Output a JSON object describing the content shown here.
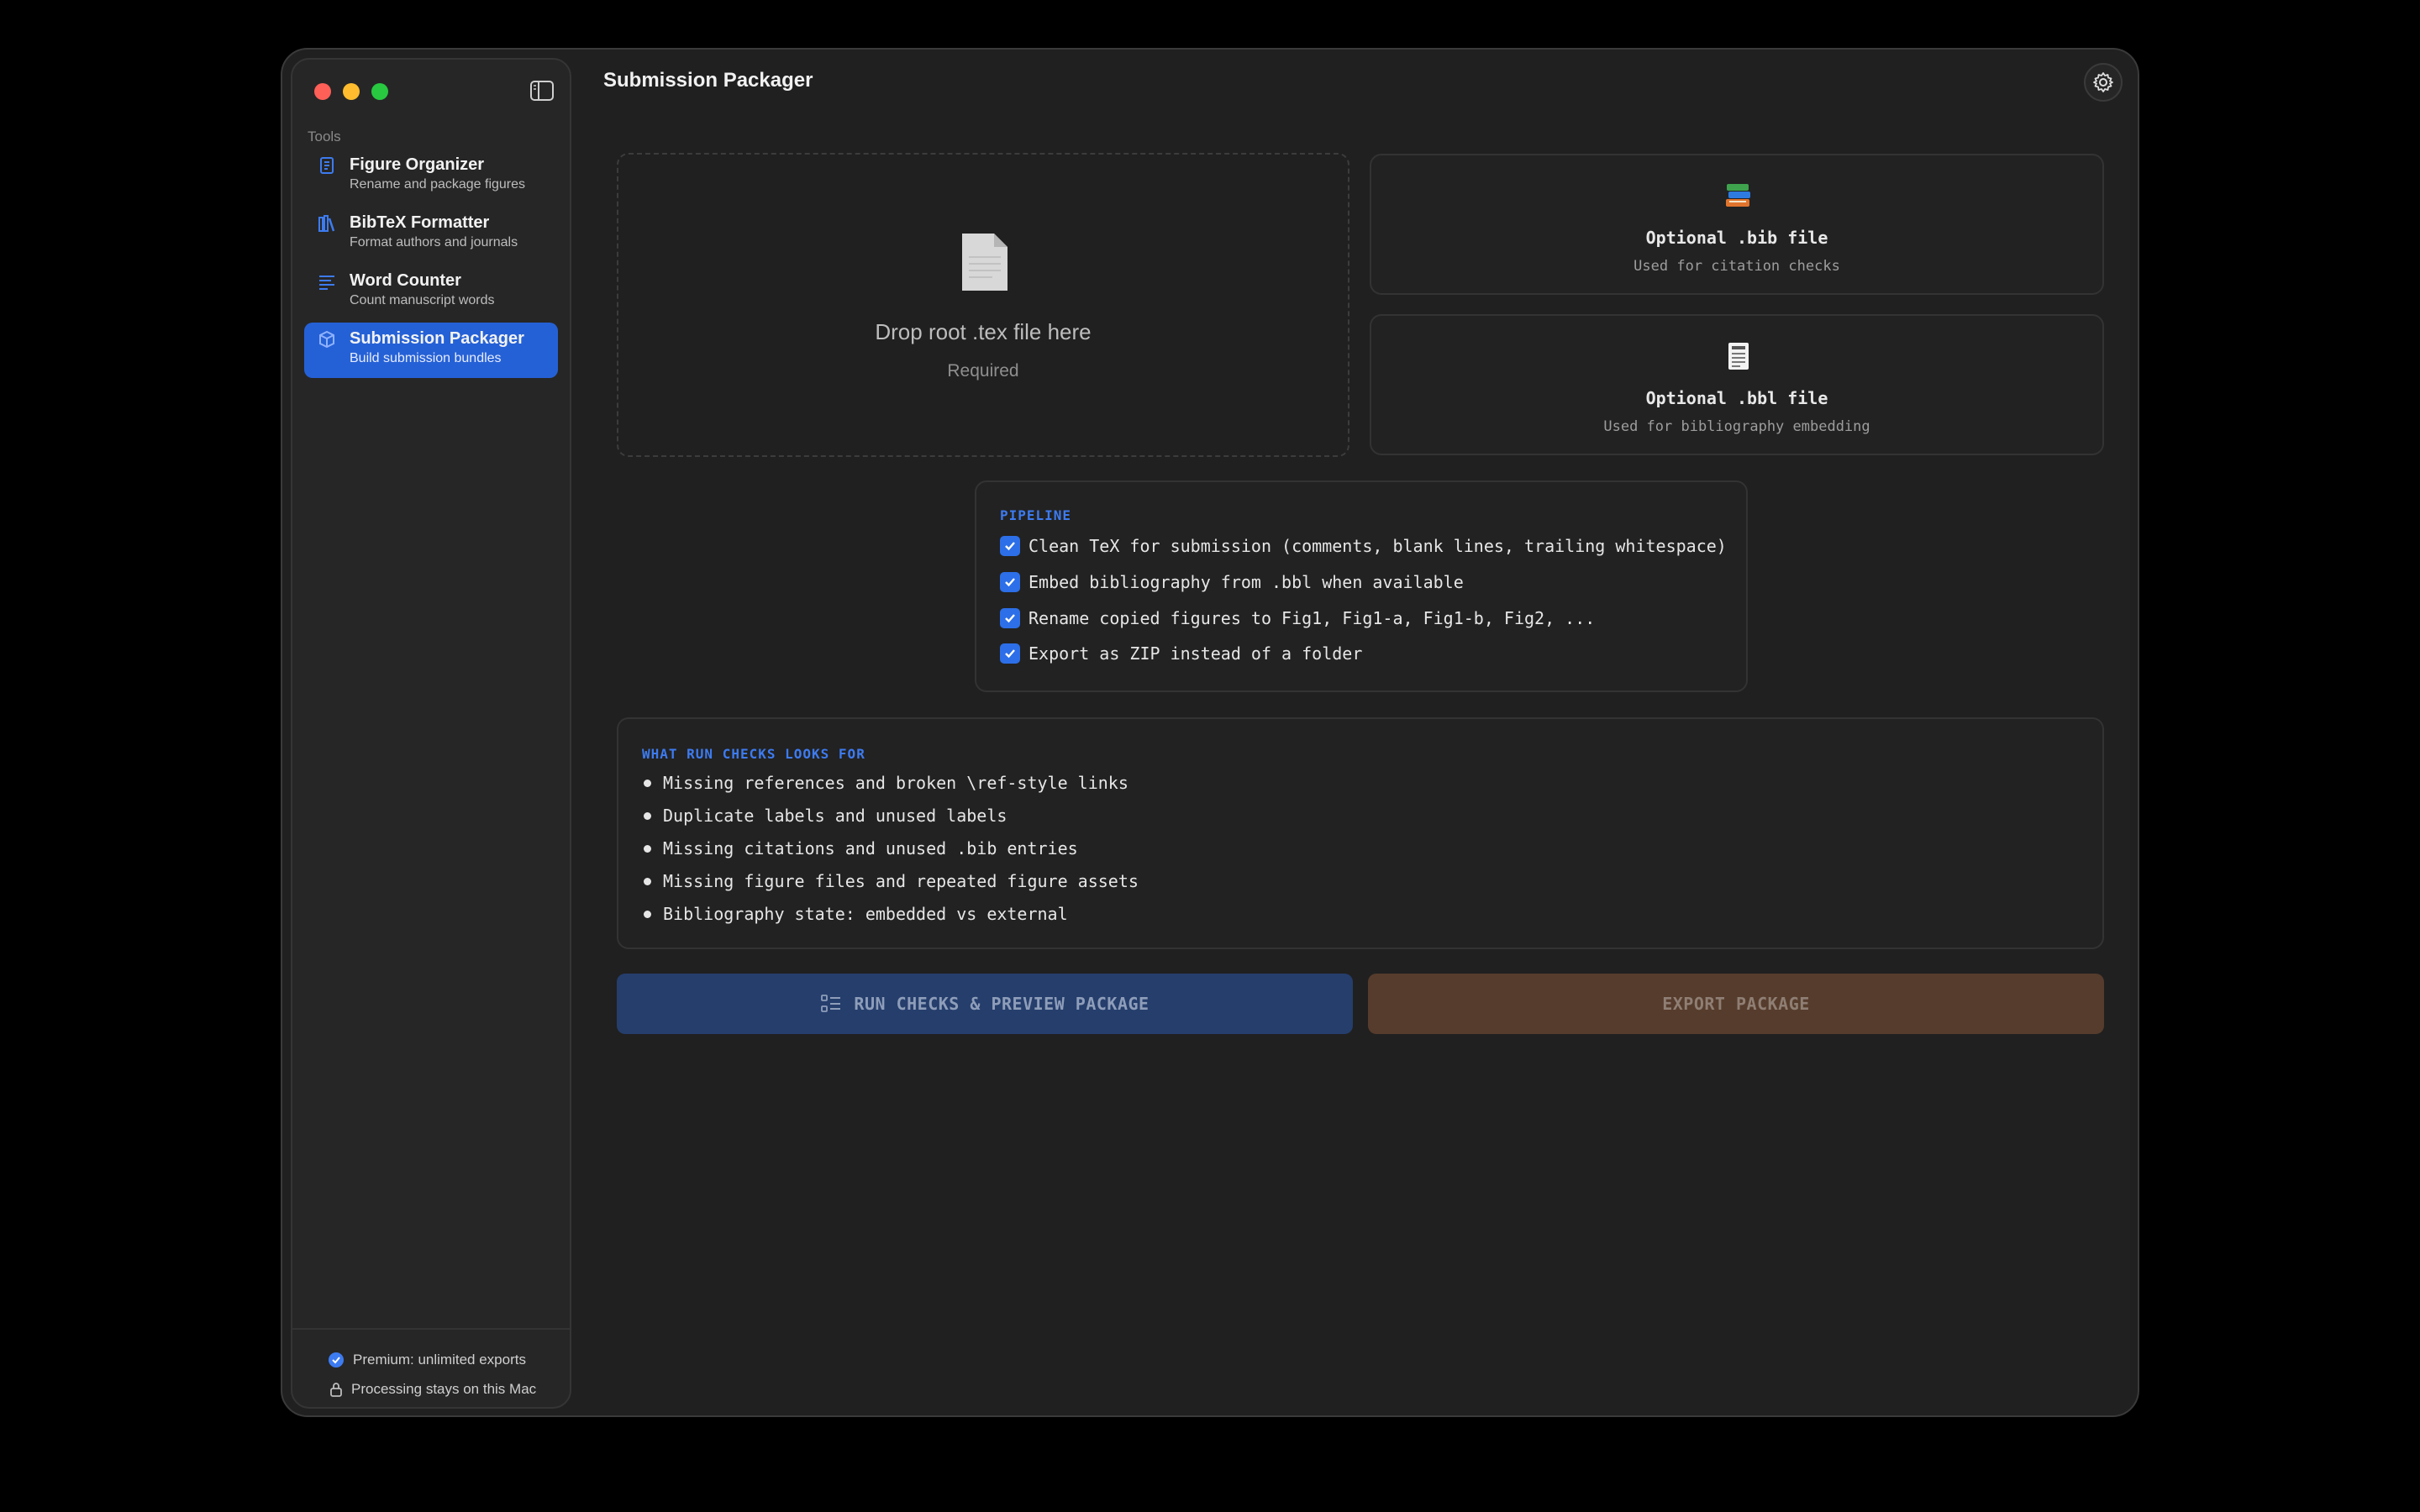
{
  "window": {
    "title": "Submission Packager"
  },
  "sidebar": {
    "section_label": "Tools",
    "items": [
      {
        "title": "Figure Organizer",
        "subtitle": "Rename and package figures",
        "icon": "figure-doc-icon",
        "active": false
      },
      {
        "title": "BibTeX Formatter",
        "subtitle": "Format authors and journals",
        "icon": "books-icon",
        "active": false
      },
      {
        "title": "Word Counter",
        "subtitle": "Count manuscript words",
        "icon": "text-lines-icon",
        "active": false
      },
      {
        "title": "Submission Packager",
        "subtitle": "Build submission bundles",
        "icon": "package-icon",
        "active": true
      }
    ],
    "footer": {
      "premium": "Premium: unlimited exports",
      "privacy": "Processing stays on this Mac"
    }
  },
  "dropzone": {
    "title": "Drop root .tex file here",
    "subtitle": "Required"
  },
  "optional": {
    "bib": {
      "title": "Optional .bib file",
      "subtitle": "Used for citation checks"
    },
    "bbl": {
      "title": "Optional .bbl file",
      "subtitle": "Used for bibliography embedding"
    }
  },
  "pipeline": {
    "title": "PIPELINE",
    "options": [
      {
        "label": "Clean TeX for submission (comments, blank lines, trailing whitespace)",
        "checked": true
      },
      {
        "label": "Embed bibliography from .bbl when available",
        "checked": true
      },
      {
        "label": "Rename copied figures to Fig1, Fig1-a, Fig1-b, Fig2, ...",
        "checked": true
      },
      {
        "label": "Export as ZIP instead of a folder",
        "checked": true
      }
    ]
  },
  "checks": {
    "title": "WHAT RUN CHECKS LOOKS FOR",
    "items": [
      "Missing references and broken \\ref-style links",
      "Duplicate labels and unused labels",
      "Missing citations and unused .bib entries",
      "Missing figure files and repeated figure assets",
      "Bibliography state: embedded vs external"
    ]
  },
  "actions": {
    "run_label": "RUN CHECKS & PREVIEW PACKAGE",
    "export_label": "EXPORT PACKAGE"
  },
  "colors": {
    "accent": "#2561d6",
    "run_button": "#253e6c",
    "export_button": "#563c2c"
  }
}
